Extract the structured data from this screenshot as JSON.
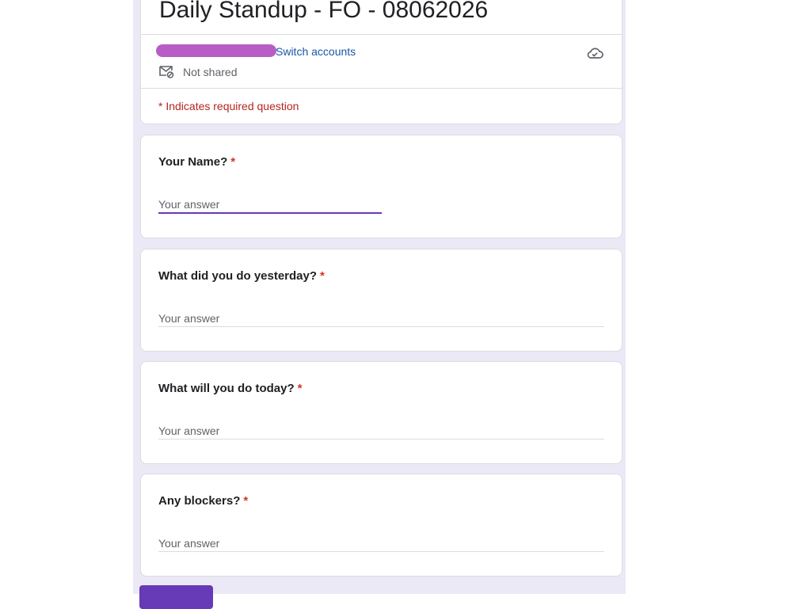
{
  "form": {
    "title": "Daily Standup - FO - 08062026",
    "switch_accounts": "Switch accounts",
    "share_status": "Not shared",
    "required_note": "* Indicates required question"
  },
  "questions": [
    {
      "label": "Your Name?",
      "required_mark": "*",
      "placeholder": "Your answer",
      "focused": true
    },
    {
      "label": "What did you do yesterday?",
      "required_mark": "*",
      "placeholder": "Your answer",
      "focused": false
    },
    {
      "label": "What will you do today?",
      "required_mark": "*",
      "placeholder": "Your answer",
      "focused": false
    },
    {
      "label": "Any blockers?",
      "required_mark": "*",
      "placeholder": "Your answer",
      "focused": false
    }
  ],
  "colors": {
    "accent": "#673ab7",
    "background": "#ece9f6",
    "required": "#d93025",
    "link": "#1a56a8"
  },
  "icons": {
    "share": "email-share-icon",
    "cloud": "cloud-saved-icon"
  }
}
